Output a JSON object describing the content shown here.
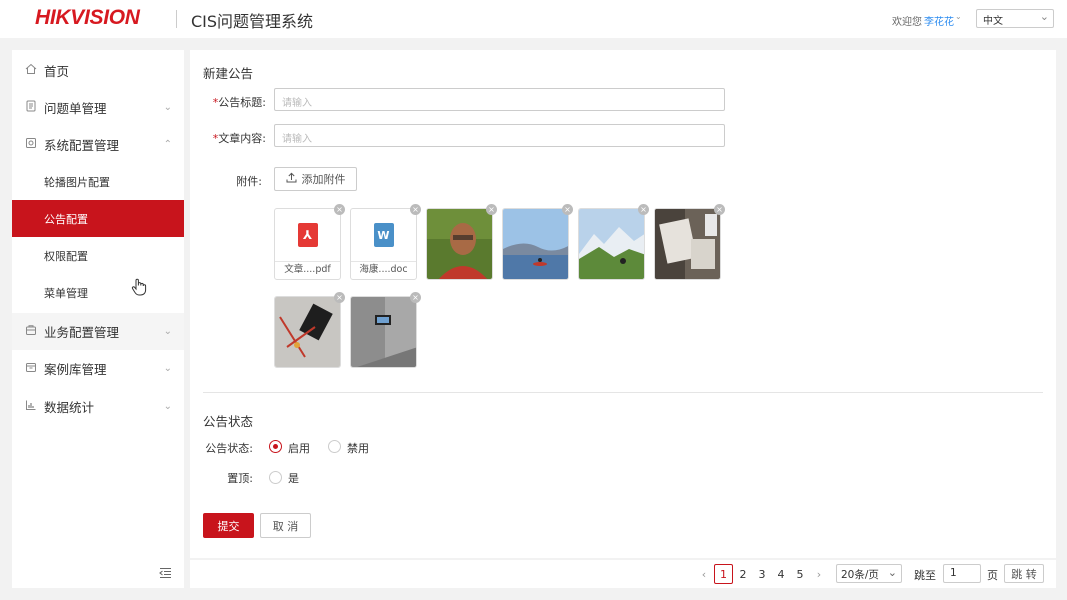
{
  "header": {
    "logo_text": "HIKVISION",
    "app_title": "CIS问题管理系统",
    "welcome": "欢迎您",
    "username": "李花花",
    "language": "中文"
  },
  "sidebar": {
    "items": [
      {
        "label": "首页",
        "icon": "home-icon"
      },
      {
        "label": "问题单管理",
        "icon": "document-icon"
      },
      {
        "label": "系统配置管理",
        "icon": "settings-icon"
      },
      {
        "label": "业务配置管理",
        "icon": "briefcase-icon"
      },
      {
        "label": "案例库管理",
        "icon": "folder-icon"
      },
      {
        "label": "数据统计",
        "icon": "chart-icon"
      }
    ],
    "subitems": [
      {
        "label": "轮播图片配置"
      },
      {
        "label": "公告配置"
      },
      {
        "label": "权限配置"
      },
      {
        "label": "菜单管理"
      }
    ]
  },
  "form": {
    "section_title": "新建公告",
    "title_label": "公告标题:",
    "title_placeholder": "请输入",
    "content_label": "文章内容:",
    "content_placeholder": "请输入",
    "attachment_label": "附件:",
    "add_attachment": "添加附件",
    "files": [
      {
        "name": "文章....pdf",
        "type": "pdf"
      },
      {
        "name": "海康....doc",
        "type": "doc"
      }
    ],
    "status_section_title": "公告状态",
    "status_label": "公告状态:",
    "status_options": [
      "启用",
      "禁用"
    ],
    "status_selected": "启用",
    "pin_label": "置顶:",
    "pin_option": "是",
    "submit_label": "提交",
    "cancel_label": "取 消"
  },
  "pagination": {
    "pages": [
      "1",
      "2",
      "3",
      "4",
      "5"
    ],
    "current": "1",
    "page_size": "20条/页",
    "jump_to": "跳至",
    "jump_value": "1",
    "page_unit": "页",
    "go_label": "跳 转"
  },
  "colors": {
    "brand_red": "#c8141c",
    "link_blue": "#2d8cf0"
  }
}
